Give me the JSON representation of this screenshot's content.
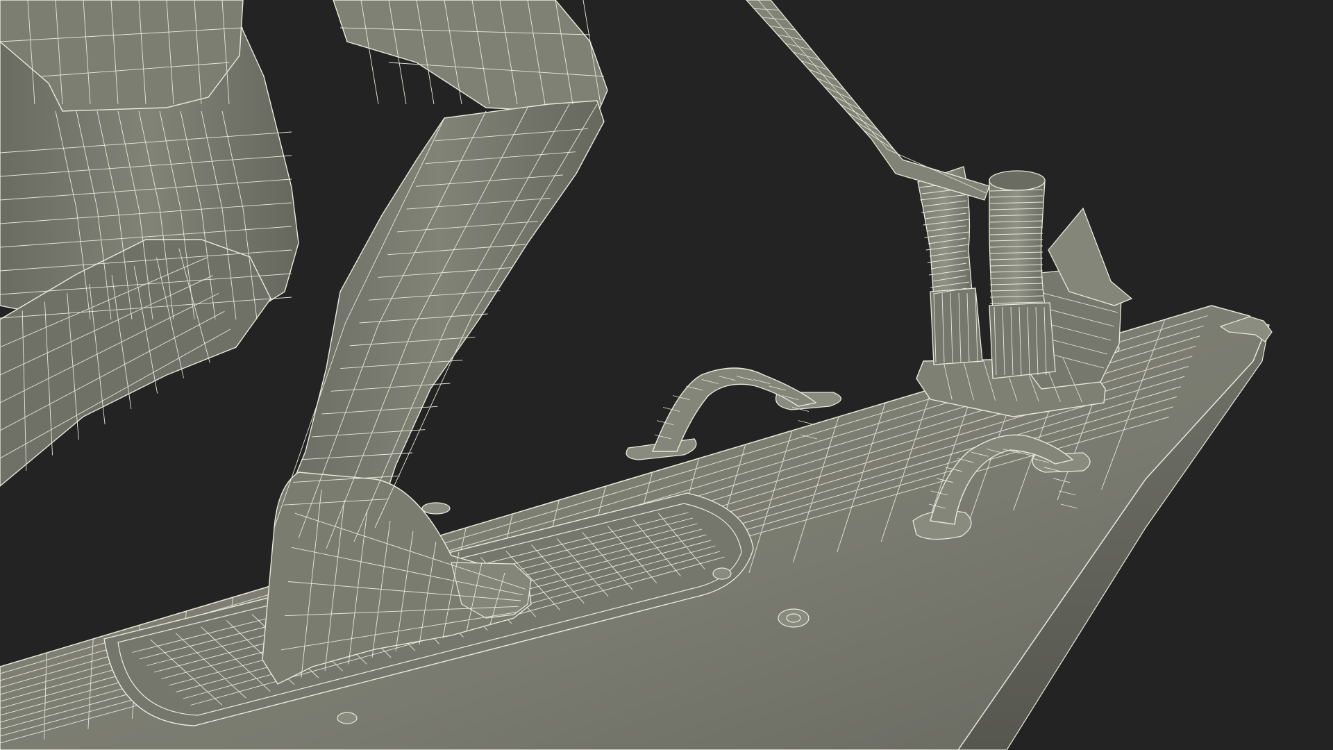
{
  "scene": {
    "background_color": "#232323",
    "mesh_fill_color": "#7d7e72",
    "mesh_shadow_color": "#5f6057",
    "mesh_highlight_color": "#8f9084",
    "wireframe_color": "#e9e9dc"
  }
}
